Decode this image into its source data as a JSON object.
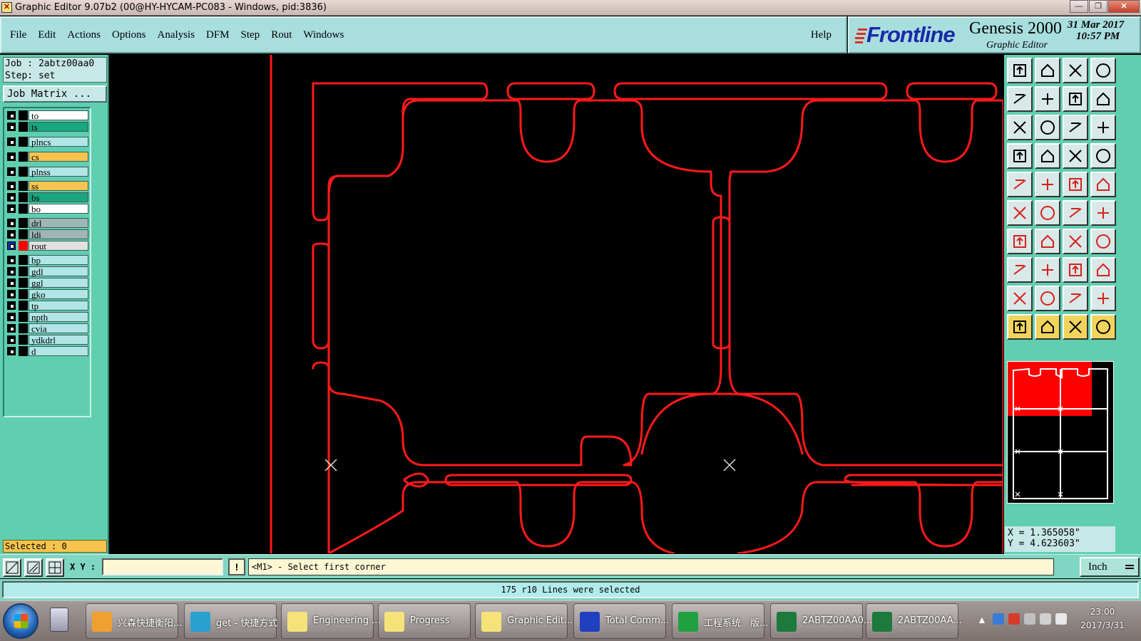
{
  "window": {
    "title": "Graphic Editor 9.07b2 (00@HY-HYCAM-PC083 - Windows, pid:3836)",
    "minimize": "—",
    "restore": "❐",
    "close": "✕"
  },
  "menu": {
    "items": [
      "File",
      "Edit",
      "Actions",
      "Options",
      "Analysis",
      "DFM",
      "Step",
      "Rout",
      "Windows"
    ],
    "help": "Help"
  },
  "logo": {
    "brand": "Frontline",
    "product": "Genesis 2000",
    "subtitle": "Graphic Editor",
    "date": "31 Mar 2017",
    "time": "10:57 PM"
  },
  "job": {
    "job_line": "Job : 2abtz00aa0",
    "step_line": "Step: set",
    "matrix_button": "Job Matrix ..."
  },
  "layers": [
    {
      "name": "to",
      "color": "#ffffff",
      "active": false
    },
    {
      "name": "ts",
      "color": "#19a77d",
      "active": false
    },
    {
      "name": "plncs",
      "color": "#b2e6e6",
      "active": false
    },
    {
      "name": "cs",
      "color": "#f6c44e",
      "active": false
    },
    {
      "name": "plnss",
      "color": "#b2e6e6",
      "active": false
    },
    {
      "name": "ss",
      "color": "#f6c44e",
      "active": false
    },
    {
      "name": "bs",
      "color": "#19a77d",
      "active": false
    },
    {
      "name": "bo",
      "color": "#ffffff",
      "active": false
    },
    {
      "name": "drl",
      "color": "#9fb6b6",
      "active": false
    },
    {
      "name": "ldi",
      "color": "#9fb6b6",
      "active": false
    },
    {
      "name": "rout",
      "color": "#e0e0e0",
      "active": true,
      "display_color": "#ff0000"
    },
    {
      "name": "bp",
      "color": "#b2e6e6",
      "active": false
    },
    {
      "name": "gdl",
      "color": "#b2e6e6",
      "active": false
    },
    {
      "name": "ggl",
      "color": "#b2e6e6",
      "active": false
    },
    {
      "name": "gko",
      "color": "#b2e6e6",
      "active": false
    },
    {
      "name": "tp",
      "color": "#b2e6e6",
      "active": false
    },
    {
      "name": "npth",
      "color": "#b2e6e6",
      "active": false
    },
    {
      "name": "cvia",
      "color": "#b2e6e6",
      "active": false
    },
    {
      "name": "ydkdrl",
      "color": "#b2e6e6",
      "active": false
    },
    {
      "name": "d",
      "color": "#b2e6e6",
      "active": false
    }
  ],
  "selected": "Selected : 0",
  "coords": {
    "x": "X = 1.365058\"",
    "y": "Y = 4.623603\""
  },
  "command": {
    "xy_label": "X Y :",
    "xy_value": "",
    "bang": "!",
    "prompt": "<M1> - Select first corner",
    "units": "Inch"
  },
  "status_message": "175 r10 Lines were selected",
  "taskbar": {
    "items": [
      {
        "label": "兴森快捷衡阳...",
        "icon_color": "#f0a030"
      },
      {
        "label": "get - 快捷方式",
        "icon_color": "#2aa0d0"
      },
      {
        "label": "Engineering ...",
        "icon_color": "#f5e37a"
      },
      {
        "label": "Progress",
        "icon_color": "#f5e37a"
      },
      {
        "label": "Graphic Edit...",
        "icon_color": "#f5e37a"
      },
      {
        "label": "Total Comm...",
        "icon_color": "#2040c0"
      },
      {
        "label": "工程系统　版...",
        "icon_color": "#20a040"
      },
      {
        "label": "2ABTZ00AA0...",
        "icon_color": "#1d7a3c"
      },
      {
        "label": "2ABTZ00AA...",
        "icon_color": "#1d7a3c"
      }
    ],
    "clock_time": "23:00",
    "clock_date": "2017/3/31"
  },
  "colors": {
    "rout_outline": "#ff0000",
    "canvas_bg": "#000000",
    "panel_bg": "#5fcfb0",
    "menu_bg": "#a9dede"
  }
}
